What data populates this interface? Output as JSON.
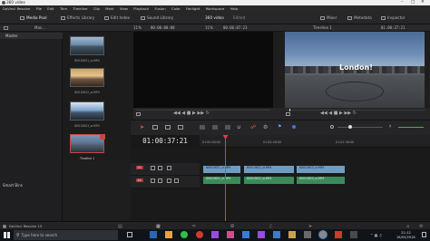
{
  "window": {
    "title": "360 video"
  },
  "menu": [
    "DaVinci Resolve",
    "File",
    "Edit",
    "Trim",
    "Timeline",
    "Clip",
    "Mark",
    "View",
    "Playback",
    "Fusion",
    "Color",
    "Fairlight",
    "Workspace",
    "Help"
  ],
  "toolbar": {
    "media_pool": "Media Pool",
    "effects_library": "Effects Library",
    "edit_index": "Edit Index",
    "sound_library": "Sound Library",
    "project_title": "360 video",
    "project_status": "Edited",
    "mixer": "Mixer",
    "metadata": "Metadata",
    "inspector": "Inspector"
  },
  "left_panel": {
    "master": "Master",
    "smart_bins": "Smart Bins",
    "view_label": "Mas..."
  },
  "media_pool": {
    "clips": [
      {
        "name": "80010621_sr.MP4"
      },
      {
        "name": "80010622_sr.MP4"
      },
      {
        "name": "80010623_sr.MP4"
      },
      {
        "name": "Timeline 1"
      }
    ]
  },
  "source_viewer": {
    "zoom": "11%",
    "timecode": "00:00:00:00"
  },
  "timeline_viewer": {
    "zoom": "11%",
    "duration": "00:06:07:23",
    "timeline_name": "Timeline 1",
    "timecode": "01:00:37:21",
    "overlay_text": "London!"
  },
  "timeline": {
    "timecode": "01:00:37:21",
    "ruler": [
      "01:00:00:00",
      "01:00:48:00",
      "01:01:36:00"
    ],
    "tracks": [
      {
        "label": "V1",
        "clips": [
          "80010621_sr.MP4",
          "80010622_sr.MP4",
          "80010623_sr.MP4"
        ]
      },
      {
        "label": "A1",
        "clips": [
          "80010621_sr.MP4",
          "80010622_sr.MP4",
          "80010623_sr.MP4"
        ]
      }
    ]
  },
  "footer": {
    "app_label": "DaVinci Resolve 15"
  },
  "taskbar": {
    "search_placeholder": "Type here to search",
    "time": "21:12",
    "date": "16/05/2018"
  },
  "colors": {
    "accent_red": "#e23b3b",
    "video_clip": "#6f9dc2",
    "audio_clip": "#3c8a5b",
    "taskbar": "#101418"
  }
}
